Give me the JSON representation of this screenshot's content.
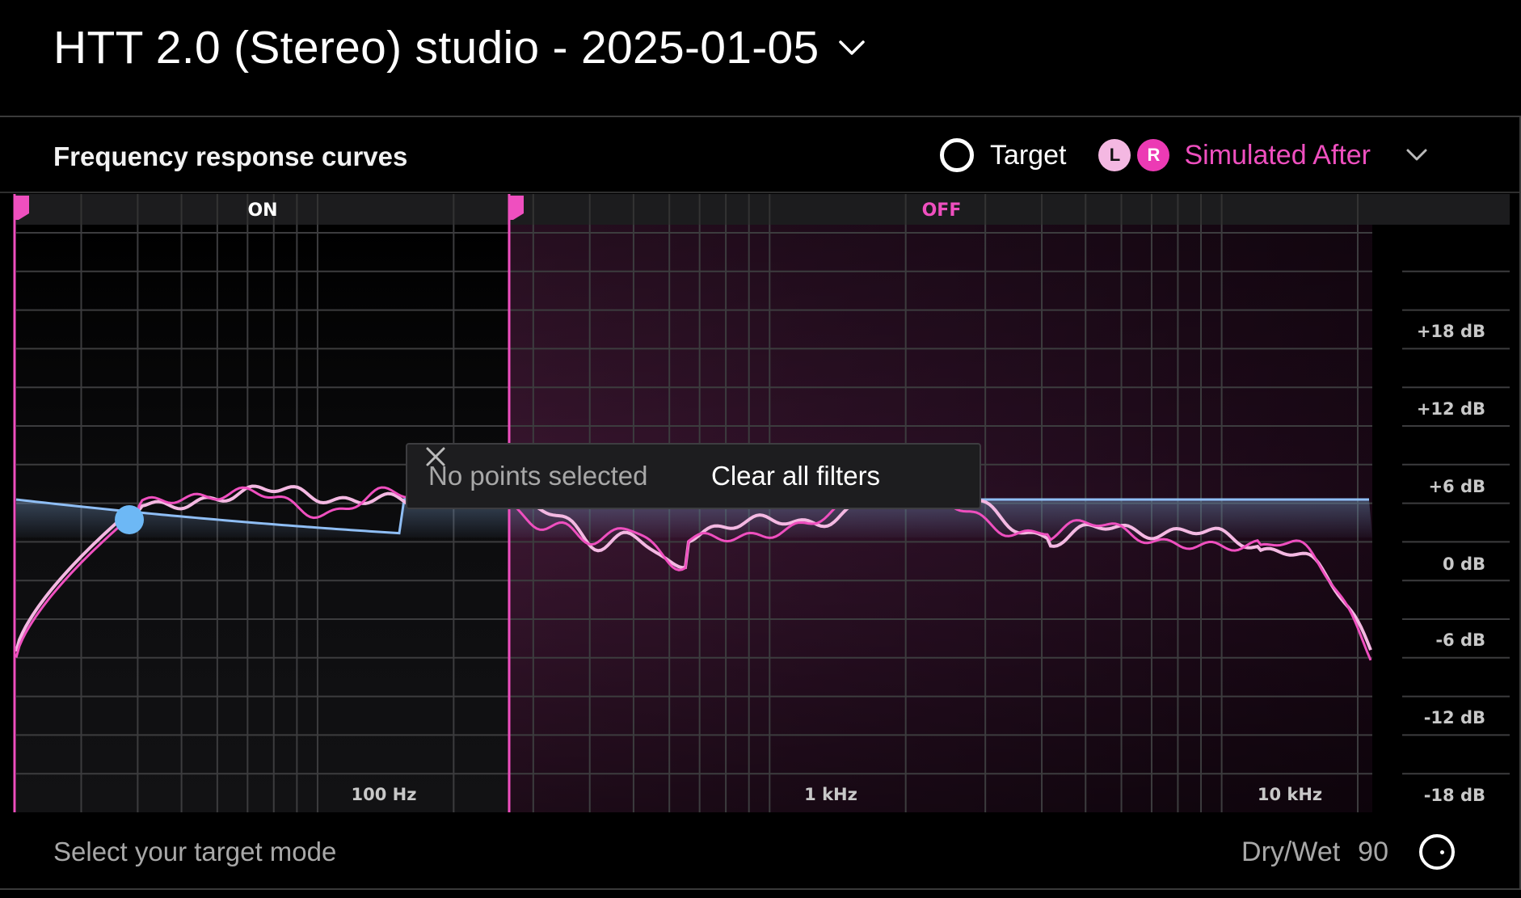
{
  "header": {
    "title": "HTT 2.0 (Stereo) studio - 2025-01-05"
  },
  "panel": {
    "title": "Frequency response curves",
    "legend": {
      "target_label": "Target",
      "left_badge": "L",
      "right_badge": "R",
      "simulated_label": "Simulated After"
    }
  },
  "zones": {
    "on_label": "ON",
    "off_label": "OFF"
  },
  "axes": {
    "y_labels": [
      "+18 dB",
      "+12 dB",
      "+6 dB",
      "0 dB",
      "-6 dB",
      "-12 dB",
      "-18 dB"
    ],
    "x_labels": [
      "100 Hz",
      "1 kHz",
      "10 kHz"
    ]
  },
  "toast": {
    "status": "No points selected",
    "clear_label": "Clear all filters"
  },
  "footer": {
    "mode_prompt": "Select your target mode",
    "drywet_label": "Dry/Wet",
    "drywet_value": "90"
  },
  "colors": {
    "accent_pink": "#ef4fbf",
    "light_pink": "#f4b8e2",
    "target_blue": "#8fbef5",
    "handle_blue": "#6db8f5"
  }
}
